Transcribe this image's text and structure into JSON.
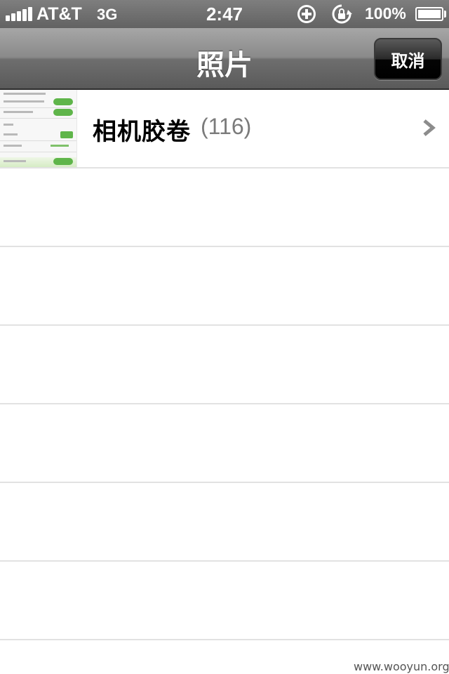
{
  "status_bar": {
    "carrier": "AT&T",
    "network": "3G",
    "time": "2:47",
    "battery_percent": "100%",
    "battery_level": 1.0,
    "icons": [
      "signal-bars-icon",
      "add-circle-icon",
      "rotation-lock-icon",
      "battery-icon"
    ]
  },
  "nav": {
    "title": "照片",
    "cancel_label": "取消"
  },
  "albums": [
    {
      "name": "相机胶卷",
      "count": "(116)",
      "thumbnail": "settings-screenshot-thumbnail",
      "chevron_icon": "chevron-right-icon"
    }
  ],
  "empty_rows": 6,
  "watermark": "www.wooyun.org",
  "colors": {
    "nav_bar": "#7a7a7a",
    "cancel_button": "#0a0a0a",
    "row_separator": "#e2e2e2",
    "count_text": "#7b7b7b",
    "chevron": "#8c8c8c"
  }
}
